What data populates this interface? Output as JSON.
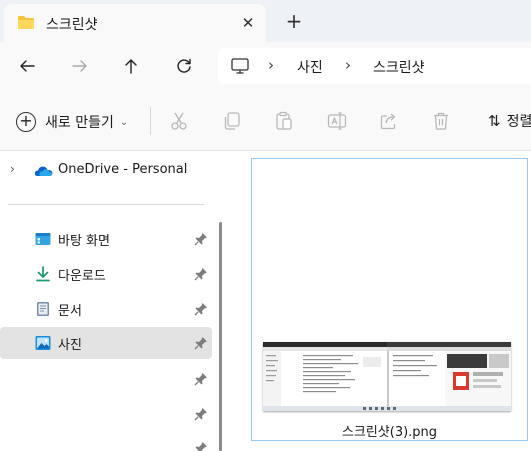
{
  "tab": {
    "title": "스크린샷",
    "close_glyph": "✕",
    "new_tab_glyph": "+"
  },
  "nav": {
    "breadcrumbs": [
      "사진",
      "스크린샷"
    ],
    "separator": "›"
  },
  "toolbar": {
    "new_label": "새로 만들기",
    "new_chevron": "⌄",
    "sort_label": "정렬",
    "sort_glyph": "⇅",
    "icons": [
      "cut-icon",
      "copy-icon",
      "paste-icon",
      "rename-icon",
      "share-icon",
      "delete-icon"
    ]
  },
  "sidebar": {
    "onedrive": {
      "label": "OneDrive - Personal",
      "expander": "›"
    },
    "quick_access": [
      {
        "label": "바탕 화면",
        "icon": "desktop-icon",
        "pinned": true,
        "selected": false
      },
      {
        "label": "다운로드",
        "icon": "download-icon",
        "pinned": true,
        "selected": false
      },
      {
        "label": "문서",
        "icon": "document-icon",
        "pinned": true,
        "selected": false
      },
      {
        "label": "사진",
        "icon": "pictures-icon",
        "pinned": true,
        "selected": true
      }
    ]
  },
  "files": [
    {
      "name": "스크린샷(3).png",
      "selected": true
    }
  ],
  "colors": {
    "accent": "#0067c0",
    "folder_yellow": "#f4c340",
    "selection_border": "#99c9ef",
    "sidebar_selected": "#e3e3e3",
    "tabstrip_bg": "#eef1f6"
  }
}
